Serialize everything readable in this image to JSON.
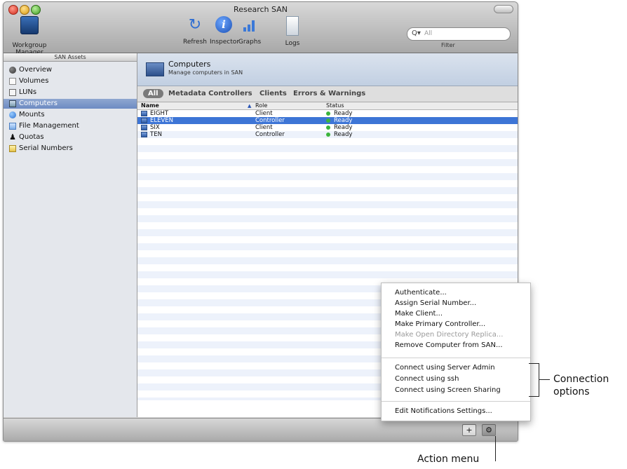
{
  "window": {
    "title": "Research SAN"
  },
  "toolbar": {
    "workgroup_manager_label": "Workgroup Manager",
    "refresh_label": "Refresh",
    "inspector_label": "Inspector",
    "graphs_label": "Graphs",
    "logs_label": "Logs",
    "search_placeholder": "All",
    "filter_label": "Filter"
  },
  "sidebar": {
    "header": "SAN Assets",
    "items": [
      {
        "label": "Overview",
        "icon": "globe-icon"
      },
      {
        "label": "Volumes",
        "icon": "volume-icon"
      },
      {
        "label": "LUNs",
        "icon": "disk-icon"
      },
      {
        "label": "Computers",
        "icon": "computer-icon",
        "selected": true
      },
      {
        "label": "Mounts",
        "icon": "mount-icon"
      },
      {
        "label": "File Management",
        "icon": "folder-icon"
      },
      {
        "label": "Quotas",
        "icon": "person-icon"
      },
      {
        "label": "Serial Numbers",
        "icon": "serial-icon"
      }
    ]
  },
  "main": {
    "header_title": "Computers",
    "header_subtitle": "Manage computers in SAN",
    "tabs": [
      "All",
      "Metadata Controllers",
      "Clients",
      "Errors & Warnings"
    ],
    "columns": [
      "Name",
      "Role",
      "Status"
    ],
    "rows": [
      {
        "name": "EIGHT",
        "role": "Client",
        "status": "Ready"
      },
      {
        "name": "ELEVEN",
        "role": "Controller",
        "status": "Ready",
        "selected": true
      },
      {
        "name": "SIX",
        "role": "Client",
        "status": "Ready"
      },
      {
        "name": "TEN",
        "role": "Controller",
        "status": "Ready"
      }
    ]
  },
  "action_menu": {
    "items": [
      {
        "label": "Authenticate...",
        "enabled": true
      },
      {
        "label": "Assign Serial Number...",
        "enabled": true
      },
      {
        "label": "Make Client...",
        "enabled": true
      },
      {
        "label": "Make Primary Controller...",
        "enabled": true
      },
      {
        "label": "Make Open Directory Replica...",
        "enabled": false
      },
      {
        "label": "Remove Computer from SAN...",
        "enabled": true
      },
      {
        "label": "Connect using Server Admin",
        "enabled": true
      },
      {
        "label": "Connect using ssh",
        "enabled": true
      },
      {
        "label": "Connect using Screen Sharing",
        "enabled": true
      },
      {
        "label": "Edit Notifications Settings...",
        "enabled": true
      }
    ]
  },
  "bottom": {
    "add_label": "+",
    "action_label": "⚙"
  },
  "callouts": {
    "connection_line1": "Connection",
    "connection_line2": "options",
    "action_menu": "Action menu"
  },
  "colors": {
    "selection": "#3d75d6",
    "sidebar_selection": "#6d8bc3",
    "status_ready": "#3cb43c"
  }
}
